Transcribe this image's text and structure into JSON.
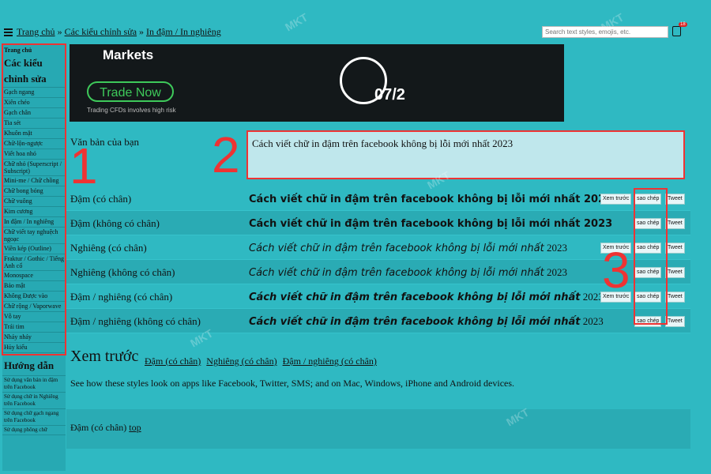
{
  "header": {
    "breadcrumb": [
      "Trang chủ",
      "Các kiểu chỉnh sửa",
      "In đậm / In nghiêng"
    ],
    "separator": "»",
    "search_placeholder": "Search text styles, emojis, etc.",
    "cart_count": "18"
  },
  "sidebar": {
    "home": "Trang chủ",
    "heading": "Các kiểu chỉnh sửa",
    "items": [
      "Gạch ngang",
      "Xiên chéo",
      "Gạch chân",
      "Tia sét",
      "Khuôn mặt",
      "Chữ-lộn-ngược",
      "Viết hoa nhỏ",
      "Chữ nhỏ (Superscript / Subscript)",
      "Mini-me / Chữ chồng",
      "Chữ bong bóng",
      "Chữ vuông",
      "Kim cương",
      "In đậm / In nghiêng",
      "Chữ viết tay nghuệch ngoạc",
      "Viền kép (Outline)",
      "Fraktur / Gothic / Tiếng Anh cổ",
      "Monospace",
      "Bảo mật",
      "Không Được vào",
      "Chữ rộng / Vaporwave",
      "Vỗ tay",
      "Trái tim",
      "Nháy nháy",
      "Hủy kiểu"
    ],
    "guide_heading": "Hướng dẫn",
    "guides": [
      "Sử dụng văn bản in đậm trên Facebook",
      "Sử dụng chữ in Nghiêng trên Facebook",
      "Sử dụng chữ gạch ngang trên Facebook",
      "Sử dụng phông chữ"
    ]
  },
  "ad": {
    "title": "Markets",
    "button": "Trade Now",
    "note": "Trading CFDs involves high risk",
    "date": "07/2"
  },
  "input": {
    "label": "Văn bản của bạn",
    "value": "Cách viết chữ in đậm trên facebook không bị lỗi mới nhất 2023"
  },
  "rows": [
    {
      "label": "Đậm (có chân)",
      "text": "Cách viết chữ in đậm trên facebook không bị lỗi mới nhất 2023",
      "tail": "",
      "style": "bold",
      "preview": true
    },
    {
      "label": "Đậm (không có chân)",
      "text": "Cách viết chữ in đậm trên facebook không bị lỗi mới nhất 2023",
      "tail": "",
      "style": "bold",
      "preview": false
    },
    {
      "label": "Nghiêng (có chân)",
      "text": "Cách viết chữ in đậm trên facebook không bị lỗi mới nhất",
      "tail": " 2023",
      "style": "italic",
      "preview": true
    },
    {
      "label": "Nghiêng (không có chân)",
      "text": "Cách viết chữ in đậm trên facebook không bị lỗi mới nhất",
      "tail": " 2023",
      "style": "italic",
      "preview": false
    },
    {
      "label": "Đậm / nghiêng (có chân)",
      "text": "Cách viết chữ in đậm trên facebook không bị lỗi mới nhất",
      "tail": " 2023",
      "style": "bi",
      "preview": true
    },
    {
      "label": "Đậm / nghiêng (không có chân)",
      "text": "Cách viết chữ in đậm trên facebook không bị lỗi mới nhất",
      "tail": " 2023",
      "style": "bi",
      "preview": false
    }
  ],
  "buttons": {
    "preview": "Xem trước",
    "copy": "sao chép",
    "tweet": "Tweet"
  },
  "preview": {
    "title": "Xem trước",
    "links": [
      "Đậm (có chân)",
      "Nghiêng (có chân)",
      "Đậm / nghiêng (có chân)"
    ],
    "description": "See how these styles look on apps like Facebook, Twitter, SMS; and on Mac, Windows, iPhone and Android devices."
  },
  "bottom": {
    "label": "Đậm (có chân)",
    "link": "top"
  },
  "annotations": [
    "1",
    "2",
    "3"
  ],
  "watermark": "MKT"
}
